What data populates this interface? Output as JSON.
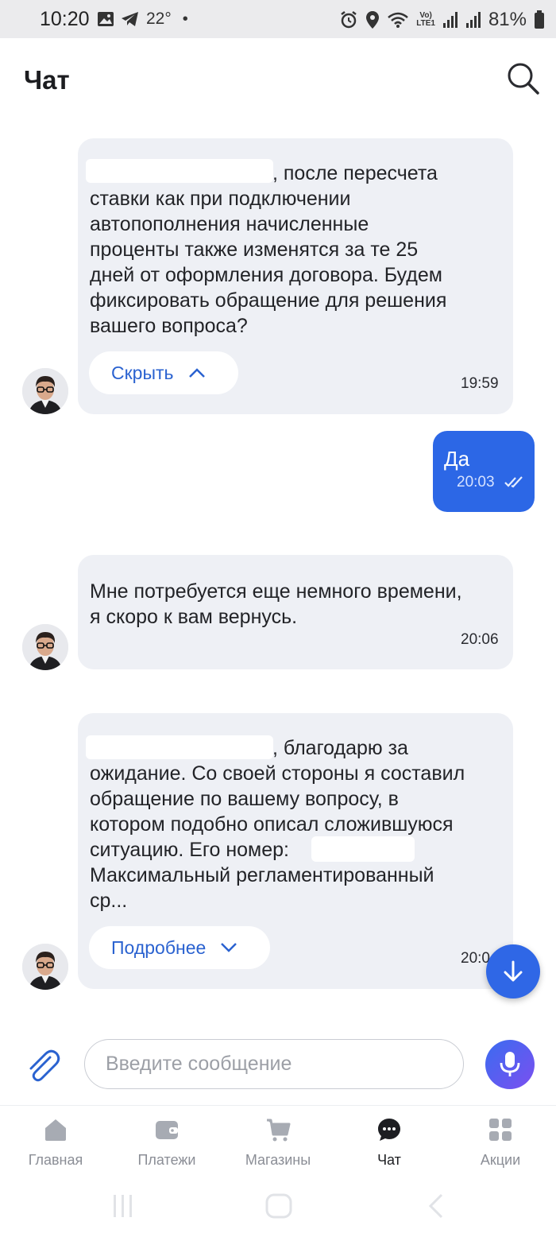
{
  "status_bar": {
    "time": "10:20",
    "temperature": "22°",
    "dot": "•",
    "volte_line1": "Vo)",
    "volte_line2": "LTE1",
    "battery": "81%"
  },
  "header": {
    "title": "Чат"
  },
  "messages": [
    {
      "direction": "incoming",
      "text": ", после пересчета ставки как при подключении автопополнения начисленные проценты также изменятся за те 25 дней от оформления договора. Будем фиксировать обращение для решения вашего вопроса?",
      "line1_suffix": ", после пересчета",
      "lines_rest": "ставки как при подключении\nавтопополнения начисленные\nпроценты также изменятся за те 25\nдней от оформления договора. Будем\nфиксировать обращение для решения\nвашего вопроса?",
      "toggle_label": "Скрыть",
      "time": "19:59"
    },
    {
      "direction": "outgoing",
      "text": "Да",
      "time": "20:03"
    },
    {
      "direction": "incoming",
      "text": "Мне потребуется еще немного времени,\nя скоро к вам вернусь.",
      "time": "20:06"
    },
    {
      "direction": "incoming",
      "line1_suffix": ", благодарю за",
      "lines_middle": "ожидание. Со своей стороны я составил\nобращение по вашему вопросу, в\nкотором подобно описал сложившуюся",
      "line_number_prefix": "ситуацию. Его номер:",
      "lines_end": "Максимальный регламентированный\nср...",
      "toggle_label": "Подробнее",
      "time": "20:0"
    }
  ],
  "input": {
    "placeholder": "Введите сообщение"
  },
  "nav": {
    "items": [
      {
        "label": "Главная",
        "icon": "home-icon",
        "active": false
      },
      {
        "label": "Платежи",
        "icon": "wallet-icon",
        "active": false
      },
      {
        "label": "Магазины",
        "icon": "cart-icon",
        "active": false
      },
      {
        "label": "Чат",
        "icon": "chat-icon",
        "active": true
      },
      {
        "label": "Акции",
        "icon": "grid-icon",
        "active": false
      }
    ]
  },
  "colors": {
    "accent": "#2c67e6",
    "bubble_incoming": "#eef0f5",
    "link": "#2a62d0"
  }
}
